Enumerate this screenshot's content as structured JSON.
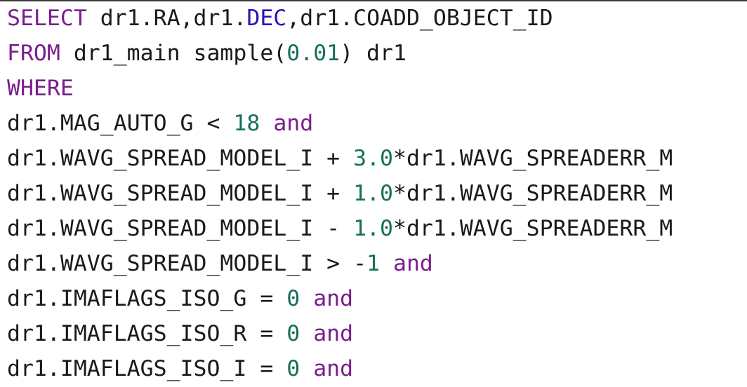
{
  "editor": {
    "language": "SQL",
    "colors": {
      "text": "#1a1a1a",
      "keyword": "#7a1e8e",
      "number": "#16705a",
      "builtin": "#2a14b4",
      "background": "#ffffff"
    },
    "lines": [
      [
        {
          "t": "kw",
          "v": "SELECT"
        },
        {
          "t": "tx",
          "v": " dr1.RA,dr1."
        },
        {
          "t": "bi",
          "v": "DEC"
        },
        {
          "t": "tx",
          "v": ",dr1.COADD_OBJECT_ID"
        }
      ],
      [
        {
          "t": "kw",
          "v": "FROM"
        },
        {
          "t": "tx",
          "v": " dr1_main sample("
        },
        {
          "t": "num",
          "v": "0.01"
        },
        {
          "t": "tx",
          "v": ") dr1"
        }
      ],
      [
        {
          "t": "kw",
          "v": "WHERE"
        }
      ],
      [
        {
          "t": "tx",
          "v": "dr1.MAG_AUTO_G < "
        },
        {
          "t": "num",
          "v": "18"
        },
        {
          "t": "tx",
          "v": " "
        },
        {
          "t": "kw",
          "v": "and"
        }
      ],
      [
        {
          "t": "tx",
          "v": "dr1.WAVG_SPREAD_MODEL_I + "
        },
        {
          "t": "num",
          "v": "3.0"
        },
        {
          "t": "tx",
          "v": "*dr1.WAVG_SPREADERR_M"
        }
      ],
      [
        {
          "t": "tx",
          "v": "dr1.WAVG_SPREAD_MODEL_I + "
        },
        {
          "t": "num",
          "v": "1.0"
        },
        {
          "t": "tx",
          "v": "*dr1.WAVG_SPREADERR_M"
        }
      ],
      [
        {
          "t": "tx",
          "v": "dr1.WAVG_SPREAD_MODEL_I - "
        },
        {
          "t": "num",
          "v": "1.0"
        },
        {
          "t": "tx",
          "v": "*dr1.WAVG_SPREADERR_M"
        }
      ],
      [
        {
          "t": "tx",
          "v": "dr1.WAVG_SPREAD_MODEL_I > -"
        },
        {
          "t": "num",
          "v": "1"
        },
        {
          "t": "tx",
          "v": " "
        },
        {
          "t": "kw",
          "v": "and"
        }
      ],
      [
        {
          "t": "tx",
          "v": "dr1.IMAFLAGS_ISO_G = "
        },
        {
          "t": "num",
          "v": "0"
        },
        {
          "t": "tx",
          "v": " "
        },
        {
          "t": "kw",
          "v": "and"
        }
      ],
      [
        {
          "t": "tx",
          "v": "dr1.IMAFLAGS_ISO_R = "
        },
        {
          "t": "num",
          "v": "0"
        },
        {
          "t": "tx",
          "v": " "
        },
        {
          "t": "kw",
          "v": "and"
        }
      ],
      [
        {
          "t": "tx",
          "v": "dr1.IMAFLAGS_ISO_I = "
        },
        {
          "t": "num",
          "v": "0"
        },
        {
          "t": "tx",
          "v": " "
        },
        {
          "t": "kw",
          "v": "and"
        }
      ]
    ]
  }
}
